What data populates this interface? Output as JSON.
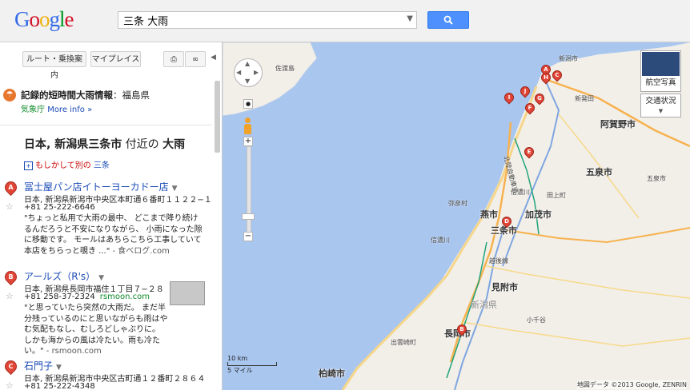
{
  "header": {
    "logo": "Google",
    "search_value": "三条 大雨",
    "search_button_icon": "search-icon"
  },
  "panel": {
    "btn_route": "ルート・乗換案内",
    "btn_myplaces": "マイプレイス",
    "alert_title": "記録的短時間大雨情報",
    "alert_region": "：福島県",
    "alert_source": "気象庁",
    "alert_more": "More info »",
    "query_location": "日本, 新潟県三条市",
    "query_near": " 付近の ",
    "query_term": "大雨",
    "alt_prefix": "もしかして別の",
    "alt_link": "三条",
    "results": [
      {
        "marker": "A",
        "name": "冨士屋パン店イトーヨーカドー店",
        "address": "日本, 新潟県新潟市中央区本町通６番町１１２２−１",
        "phone": "+81 25-222-6646",
        "domain": "",
        "snippet": "\"ちょっと私用で大雨の最中、 どこまで降り続けるんだろうと不安になりながら、 小雨になった隙に移動です。 モールはあちらこちら工事していて本店をちらっと覗き ...\"",
        "source": " - 食べログ.com"
      },
      {
        "marker": "B",
        "name": "アールズ（R's）",
        "address": "日本, 新潟県長岡市福住１丁目７−２８",
        "phone": "+81 258-37-2324",
        "domain": "rsmoon.com",
        "snippet": "\"と思っていたら突然の大雨だ。 まだ半分残っているのにと思いながらも雨はやむ気配もなし、むしろどしゃぶりに。 しかも海からの風は冷たい。雨も冷たい。\"",
        "source": " - rsmoon.com"
      },
      {
        "marker": "C",
        "name": "石門子",
        "address": "日本, 新潟県新潟市中央区古町通１２番町２８６４",
        "phone": "+81 25-222-4348",
        "domain": "",
        "snippet": "",
        "source": ""
      }
    ]
  },
  "map": {
    "btn_satellite": "航空写真",
    "btn_traffic": "交通状況",
    "scale_km": "10 km",
    "scale_mi": "5 マイル",
    "copyright": "地図データ ©2013 Google, ZENRIN",
    "cities": [
      {
        "label": "阿賀野市"
      },
      {
        "label": "五泉市"
      },
      {
        "label": "燕市"
      },
      {
        "label": "加茂市"
      },
      {
        "label": "三条市"
      },
      {
        "label": "見附市"
      },
      {
        "label": "長岡市"
      },
      {
        "label": "柏崎市"
      }
    ],
    "towns": [
      "佐渡島",
      "新潟市",
      "新潟県",
      "弥彦村",
      "信濃川",
      "信濃川",
      "田上町",
      "五泉市",
      "新発田",
      "北陸自動車道",
      "越後線",
      "出雲崎町",
      "小千谷"
    ],
    "pins": [
      "A",
      "B",
      "C",
      "D",
      "E",
      "F",
      "G",
      "H",
      "I",
      "J"
    ],
    "colors": {
      "sea": "#a9c6ef",
      "land": "#f2efe9",
      "road_major": "#f7b24f",
      "pin": "#e04536"
    }
  }
}
